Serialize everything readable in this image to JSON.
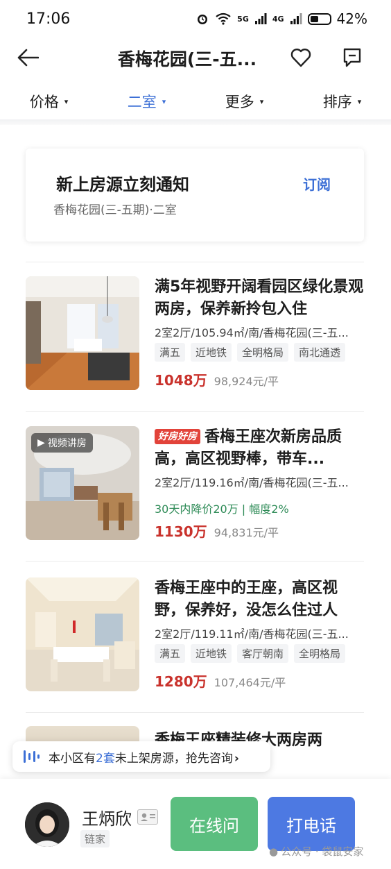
{
  "status_bar": {
    "time": "17:06",
    "signal_5g": "5G",
    "signal_4g": "4G",
    "battery_pct": "42%",
    "battery_level": 0.42,
    "icons": [
      "alarm-icon",
      "wifi-icon",
      "signal-icon",
      "battery-icon"
    ]
  },
  "header": {
    "title": "香梅花园(三-五...",
    "icons": [
      "back-arrow-icon",
      "heart-icon",
      "chat-icon"
    ]
  },
  "filters": [
    {
      "label": "价格",
      "active": false
    },
    {
      "label": "二室",
      "active": true
    },
    {
      "label": "更多",
      "active": false
    },
    {
      "label": "排序",
      "active": false
    }
  ],
  "subscribe": {
    "title": "新上房源立刻通知",
    "desc": "香梅花园(三-五期)·二室",
    "button": "订阅"
  },
  "listings": [
    {
      "title": "满5年视野开阔看园区绿化景观两房，保养新拎包入住",
      "meta": "2室2厅/105.94㎡/南/香梅花园(三-五...",
      "tags": [
        "满五",
        "近地铁",
        "全明格局",
        "南北通透"
      ],
      "price": "1048万",
      "unit_price": "98,924元/平"
    },
    {
      "badge": "视频讲房",
      "hot_tag": "好房好房",
      "title": "香梅王座次新房品质高，高区视野棒，带车...",
      "meta": "2室2厅/119.16㎡/南/香梅花园(三-五...",
      "price_drop": "30天内降价20万 | 幅度2%",
      "price": "1130万",
      "unit_price": "94,831元/平"
    },
    {
      "title": "香梅王座中的王座，高区视野，保养好，没怎么住过人",
      "meta": "2室2厅/119.11㎡/南/香梅花园(三-五...",
      "tags": [
        "满五",
        "近地铁",
        "客厅朝南",
        "全明格局"
      ],
      "price": "1280万",
      "unit_price": "107,464元/平"
    }
  ],
  "partial_listing_title": "香梅王座精装修大两房两",
  "notice": {
    "prefix": "本小区有",
    "count": "2套",
    "suffix": "未上架房源，抢先咨询",
    "arrow": "›"
  },
  "agent": {
    "name": "王炳欣",
    "company": "链家",
    "chat_label": "在线问",
    "call_label": "打电话"
  },
  "watermark": "公众号 · 袋鼠安家",
  "colors": {
    "accent_blue": "#3c6fd6",
    "price_red": "#c9322c",
    "drop_green": "#2e8b57",
    "chat_green": "#5bbe7f",
    "call_blue": "#4d79e2"
  }
}
